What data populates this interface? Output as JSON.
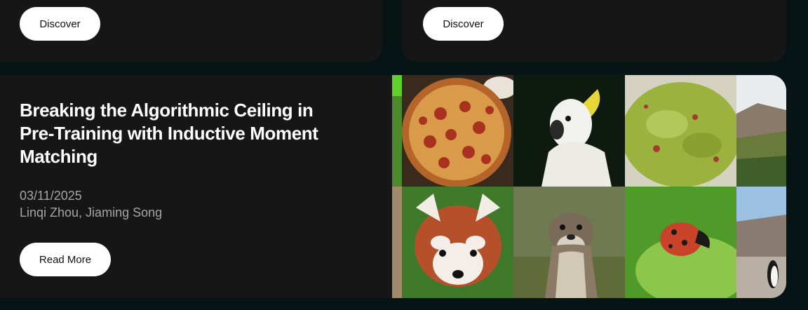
{
  "top_cards": {
    "left": {
      "button_label": "Discover"
    },
    "right": {
      "button_label": "Discover"
    }
  },
  "article": {
    "title": "Breaking the Algorithmic Ceiling in Pre-Training with Inductive Moment Matching",
    "date": "03/11/2025",
    "authors": "Linqi Zhou, Jiaming Song",
    "button_label": "Read More"
  },
  "image_grid": {
    "tiles": [
      "pizza",
      "cockatoo",
      "guacamole",
      "mountain-landscape",
      "red-panda",
      "otter",
      "ladybug",
      "penguin-beach"
    ]
  },
  "colors": {
    "page_background": "#071416",
    "card_background": "#161616",
    "button_background": "#ffffff",
    "title_text": "#ffffff",
    "meta_text": "#a5a5a5"
  }
}
